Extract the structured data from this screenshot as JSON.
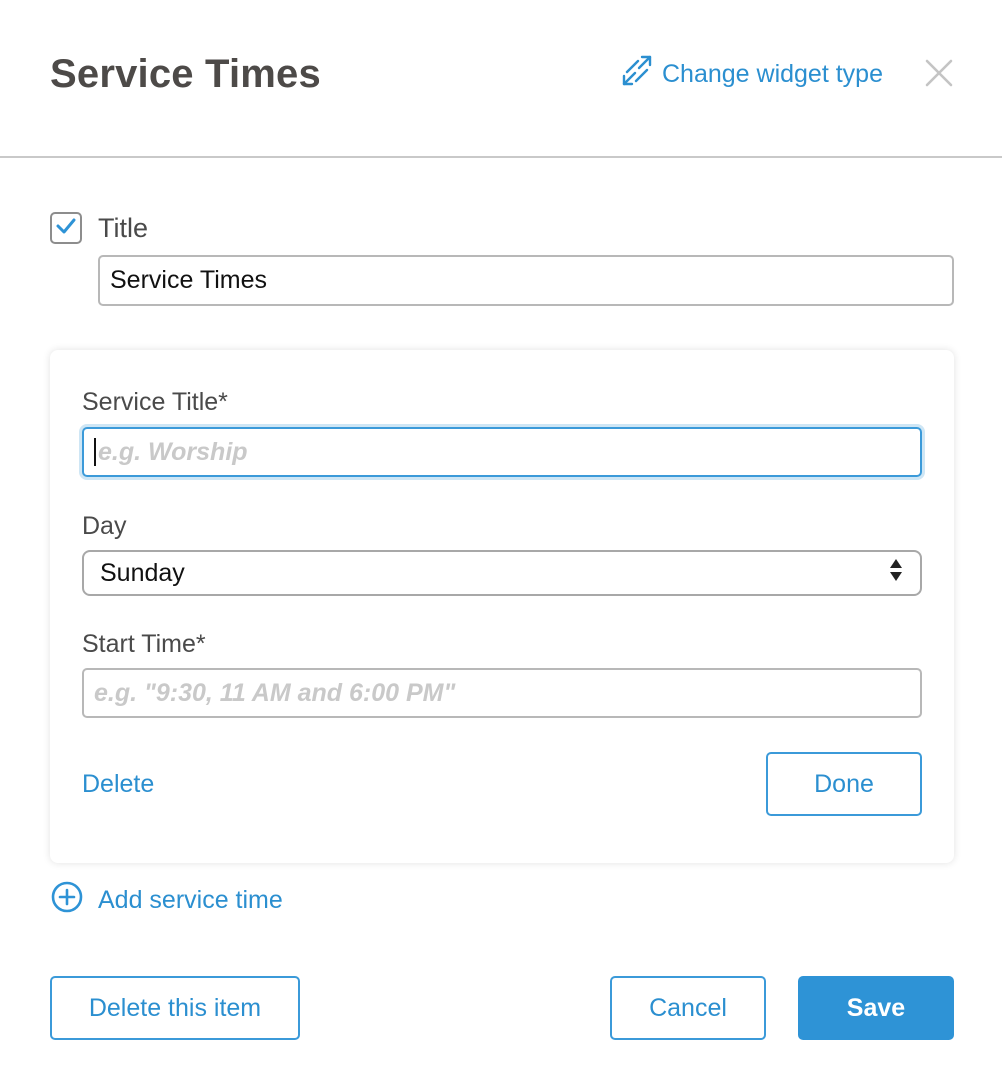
{
  "header": {
    "title": "Service Times",
    "change_widget_label": "Change widget type",
    "icons": {
      "change": "swap-arrows-icon",
      "close": "close-icon"
    }
  },
  "title_section": {
    "checkbox_checked": true,
    "label": "Title",
    "value": "Service Times"
  },
  "service_card": {
    "service_title_label": "Service Title*",
    "service_title_placeholder": "e.g. Worship",
    "day_label": "Day",
    "day_value": "Sunday",
    "start_time_label": "Start Time*",
    "start_time_placeholder": "e.g. \"9:30, 11 AM and 6:00 PM\"",
    "delete_label": "Delete",
    "done_label": "Done"
  },
  "add_service": {
    "label": "Add service time",
    "icon": "plus-circle-icon"
  },
  "footer": {
    "delete_item_label": "Delete this item",
    "cancel_label": "Cancel",
    "save_label": "Save"
  },
  "colors": {
    "accent": "#2e93d6",
    "link": "#2b8fd0",
    "title_text": "#4d4a48",
    "border": "#b8b8b8"
  }
}
